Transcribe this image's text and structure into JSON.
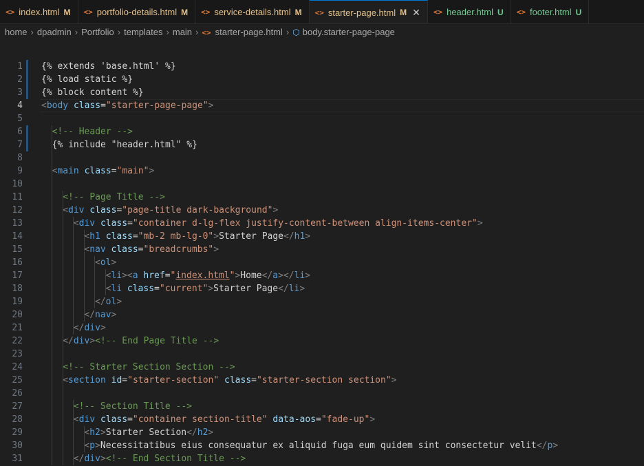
{
  "tabs": [
    {
      "name": "index.html",
      "status": "M",
      "active": false,
      "untracked": false
    },
    {
      "name": "portfolio-details.html",
      "status": "M",
      "active": false,
      "untracked": false
    },
    {
      "name": "service-details.html",
      "status": "M",
      "active": false,
      "untracked": false
    },
    {
      "name": "starter-page.html",
      "status": "M",
      "active": true,
      "untracked": false
    },
    {
      "name": "header.html",
      "status": "U",
      "active": false,
      "untracked": true
    },
    {
      "name": "footer.html",
      "status": "U",
      "active": false,
      "untracked": true
    }
  ],
  "tab_icon_glyph": "<>",
  "tab_close_glyph": "✕",
  "breadcrumb": [
    "home",
    "dpadmin",
    "Portfolio",
    "templates",
    "main",
    "starter-page.html",
    "body.starter-page-page"
  ],
  "current_line": 4,
  "gutter_marks": [
    1,
    2,
    3,
    6,
    7
  ],
  "lines": [
    {
      "n": 1,
      "indent": 0,
      "tokens": [
        [
          "t",
          "{% extends 'base.html' %}"
        ]
      ]
    },
    {
      "n": 2,
      "indent": 0,
      "tokens": [
        [
          "t",
          "{% load static %}"
        ]
      ]
    },
    {
      "n": 3,
      "indent": 0,
      "tokens": [
        [
          "t",
          "{% block content %}"
        ]
      ]
    },
    {
      "n": 4,
      "indent": 0,
      "tokens": [
        [
          "p",
          "<"
        ],
        [
          "g",
          "body"
        ],
        [
          "t",
          " "
        ],
        [
          "a",
          "class"
        ],
        [
          "t",
          "="
        ],
        [
          "s",
          "\"starter-page-page\""
        ],
        [
          "p",
          ">"
        ]
      ]
    },
    {
      "n": 5,
      "indent": 0,
      "tokens": []
    },
    {
      "n": 6,
      "indent": 1,
      "tokens": [
        [
          "c",
          "<!-- Header -->"
        ]
      ]
    },
    {
      "n": 7,
      "indent": 1,
      "tokens": [
        [
          "t",
          "{% include \"header.html\" %}"
        ]
      ]
    },
    {
      "n": 8,
      "indent": 1,
      "tokens": []
    },
    {
      "n": 9,
      "indent": 1,
      "tokens": [
        [
          "p",
          "<"
        ],
        [
          "g",
          "main"
        ],
        [
          "t",
          " "
        ],
        [
          "a",
          "class"
        ],
        [
          "t",
          "="
        ],
        [
          "s",
          "\"main\""
        ],
        [
          "p",
          ">"
        ]
      ]
    },
    {
      "n": 10,
      "indent": 1,
      "tokens": []
    },
    {
      "n": 11,
      "indent": 2,
      "tokens": [
        [
          "c",
          "<!-- Page Title -->"
        ]
      ]
    },
    {
      "n": 12,
      "indent": 2,
      "tokens": [
        [
          "p",
          "<"
        ],
        [
          "g",
          "div"
        ],
        [
          "t",
          " "
        ],
        [
          "a",
          "class"
        ],
        [
          "t",
          "="
        ],
        [
          "s",
          "\"page-title dark-background\""
        ],
        [
          "p",
          ">"
        ]
      ]
    },
    {
      "n": 13,
      "indent": 3,
      "tokens": [
        [
          "p",
          "<"
        ],
        [
          "g",
          "div"
        ],
        [
          "t",
          " "
        ],
        [
          "a",
          "class"
        ],
        [
          "t",
          "="
        ],
        [
          "s",
          "\"container d-lg-flex justify-content-between align-items-center\""
        ],
        [
          "p",
          ">"
        ]
      ]
    },
    {
      "n": 14,
      "indent": 4,
      "tokens": [
        [
          "p",
          "<"
        ],
        [
          "g",
          "h1"
        ],
        [
          "t",
          " "
        ],
        [
          "a",
          "class"
        ],
        [
          "t",
          "="
        ],
        [
          "s",
          "\"mb-2 mb-lg-0\""
        ],
        [
          "p",
          ">"
        ],
        [
          "t",
          "Starter Page"
        ],
        [
          "p",
          "</"
        ],
        [
          "g",
          "h1"
        ],
        [
          "p",
          ">"
        ]
      ]
    },
    {
      "n": 15,
      "indent": 4,
      "tokens": [
        [
          "p",
          "<"
        ],
        [
          "g",
          "nav"
        ],
        [
          "t",
          " "
        ],
        [
          "a",
          "class"
        ],
        [
          "t",
          "="
        ],
        [
          "s",
          "\"breadcrumbs\""
        ],
        [
          "p",
          ">"
        ]
      ]
    },
    {
      "n": 16,
      "indent": 5,
      "tokens": [
        [
          "p",
          "<"
        ],
        [
          "g",
          "ol"
        ],
        [
          "p",
          ">"
        ]
      ]
    },
    {
      "n": 17,
      "indent": 6,
      "tokens": [
        [
          "p",
          "<"
        ],
        [
          "g",
          "li"
        ],
        [
          "p",
          "><"
        ],
        [
          "g",
          "a"
        ],
        [
          "t",
          " "
        ],
        [
          "a",
          "href"
        ],
        [
          "t",
          "="
        ],
        [
          "s",
          "\""
        ],
        [
          "u",
          "index.html"
        ],
        [
          "s",
          "\""
        ],
        [
          "p",
          ">"
        ],
        [
          "t",
          "Home"
        ],
        [
          "p",
          "</"
        ],
        [
          "g",
          "a"
        ],
        [
          "p",
          "></"
        ],
        [
          "g",
          "li"
        ],
        [
          "p",
          ">"
        ]
      ]
    },
    {
      "n": 18,
      "indent": 6,
      "tokens": [
        [
          "p",
          "<"
        ],
        [
          "g",
          "li"
        ],
        [
          "t",
          " "
        ],
        [
          "a",
          "class"
        ],
        [
          "t",
          "="
        ],
        [
          "s",
          "\"current\""
        ],
        [
          "p",
          ">"
        ],
        [
          "t",
          "Starter Page"
        ],
        [
          "p",
          "</"
        ],
        [
          "g",
          "li"
        ],
        [
          "p",
          ">"
        ]
      ]
    },
    {
      "n": 19,
      "indent": 5,
      "tokens": [
        [
          "p",
          "</"
        ],
        [
          "g",
          "ol"
        ],
        [
          "p",
          ">"
        ]
      ]
    },
    {
      "n": 20,
      "indent": 4,
      "tokens": [
        [
          "p",
          "</"
        ],
        [
          "g",
          "nav"
        ],
        [
          "p",
          ">"
        ]
      ]
    },
    {
      "n": 21,
      "indent": 3,
      "tokens": [
        [
          "p",
          "</"
        ],
        [
          "g",
          "div"
        ],
        [
          "p",
          ">"
        ]
      ]
    },
    {
      "n": 22,
      "indent": 2,
      "tokens": [
        [
          "p",
          "</"
        ],
        [
          "g",
          "div"
        ],
        [
          "p",
          ">"
        ],
        [
          "c",
          "<!-- End Page Title -->"
        ]
      ]
    },
    {
      "n": 23,
      "indent": 2,
      "tokens": []
    },
    {
      "n": 24,
      "indent": 2,
      "tokens": [
        [
          "c",
          "<!-- Starter Section Section -->"
        ]
      ]
    },
    {
      "n": 25,
      "indent": 2,
      "tokens": [
        [
          "p",
          "<"
        ],
        [
          "g",
          "section"
        ],
        [
          "t",
          " "
        ],
        [
          "a",
          "id"
        ],
        [
          "t",
          "="
        ],
        [
          "s",
          "\"starter-section\""
        ],
        [
          "t",
          " "
        ],
        [
          "a",
          "class"
        ],
        [
          "t",
          "="
        ],
        [
          "s",
          "\"starter-section section\""
        ],
        [
          "p",
          ">"
        ]
      ]
    },
    {
      "n": 26,
      "indent": 2,
      "tokens": []
    },
    {
      "n": 27,
      "indent": 3,
      "tokens": [
        [
          "c",
          "<!-- Section Title -->"
        ]
      ]
    },
    {
      "n": 28,
      "indent": 3,
      "tokens": [
        [
          "p",
          "<"
        ],
        [
          "g",
          "div"
        ],
        [
          "t",
          " "
        ],
        [
          "a",
          "class"
        ],
        [
          "t",
          "="
        ],
        [
          "s",
          "\"container section-title\""
        ],
        [
          "t",
          " "
        ],
        [
          "a",
          "data-aos"
        ],
        [
          "t",
          "="
        ],
        [
          "s",
          "\"fade-up\""
        ],
        [
          "p",
          ">"
        ]
      ]
    },
    {
      "n": 29,
      "indent": 4,
      "tokens": [
        [
          "p",
          "<"
        ],
        [
          "g",
          "h2"
        ],
        [
          "p",
          ">"
        ],
        [
          "t",
          "Starter Section"
        ],
        [
          "p",
          "</"
        ],
        [
          "g",
          "h2"
        ],
        [
          "p",
          ">"
        ]
      ]
    },
    {
      "n": 30,
      "indent": 4,
      "tokens": [
        [
          "p",
          "<"
        ],
        [
          "g",
          "p"
        ],
        [
          "p",
          ">"
        ],
        [
          "t",
          "Necessitatibus eius consequatur ex aliquid fuga eum quidem sint consectetur velit"
        ],
        [
          "p",
          "</"
        ],
        [
          "g",
          "p"
        ],
        [
          "p",
          ">"
        ]
      ]
    },
    {
      "n": 31,
      "indent": 3,
      "tokens": [
        [
          "p",
          "</"
        ],
        [
          "g",
          "div"
        ],
        [
          "p",
          ">"
        ],
        [
          "c",
          "<!-- End Section Title -->"
        ]
      ]
    }
  ]
}
